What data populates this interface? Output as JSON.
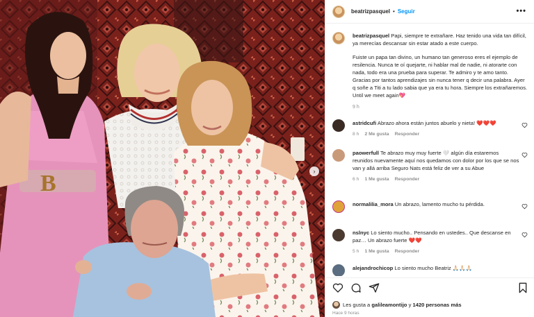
{
  "header": {
    "username": "beatrizpasquel",
    "separator": "•",
    "follow_label": "Seguir",
    "more_label": "•••"
  },
  "photo": {
    "next_label": "›",
    "belt_monogram": "B"
  },
  "caption": {
    "username": "beatrizpasquel",
    "p1": "Papi, siempre te extrañare. Haz tenido una vida tan difícil, ya merecías descansar sin estar atado a este cuerpo.",
    "p2": "Fuiste un papa tan divino, un humano tan generoso eres el ejemplo de resilencia. Nunca te oí quejarte, ni hablar mal de nadie, ni atorarte con nada, todo era una prueba para superar. Te admiro y te amo tanto. Gracias por tantos aprendizajes sin nunca tener q decir una palabra. Ayer q soñe a Titi a tu lado sabia que ya era tu hora. Siempre los extrañaremos. Until we meet again💖",
    "time": "9 h"
  },
  "comments": [
    {
      "username": "astridcufi",
      "text": "Abrazo ahora están juntos abuelo y nieta! ❤️❤️❤️",
      "time": "8 h",
      "likes": "2 Me gusta",
      "reply": "Responder",
      "avatar_color": "#3a2a24"
    },
    {
      "username": "paowerfull",
      "text": "Te abrazo muy muy fuerte 🤍 algún día estaremos reunidos nuevamente aquí nos quedamos con dolor por los que se nos van y allá arriba Seguro Nats está feliz de ver a su Abue",
      "time": "6 h",
      "likes": "1 Me gusta",
      "reply": "Responder",
      "avatar_color": "#c99a7a"
    },
    {
      "username": "normalilia_mora",
      "text": "Un abrazo, lamento mucho tu pérdida.",
      "time": "",
      "likes": "",
      "reply": "",
      "avatar_color": "#e0a33a"
    },
    {
      "username": "nslnyc",
      "text": "Lo siento mucho.. Pensando en ustedes.. Que descanse en paz… Un abrazo fuerte ❤️❤️",
      "time": "5 h",
      "likes": "1 Me gusta",
      "reply": "Responder",
      "avatar_color": "#4a3a30"
    },
    {
      "username": "alejandrochicop",
      "text": "Lo siento mucho Beatriz 🙏🏻🙏🏻🙏🏻",
      "time": "",
      "likes": "",
      "reply": "",
      "avatar_color": "#5b6d80"
    }
  ],
  "comment_like_icon": "heart-outline-icon",
  "actions": {
    "likes_prefix": "Les gusta a",
    "likes_user": "galileamontijo",
    "likes_conj": "y",
    "likes_count": "1420 personas más",
    "time_ago": "Hace 9 horas"
  },
  "colors": {
    "accent": "#0095f6",
    "heart": "#ed4956",
    "muted": "#8e8e8e"
  }
}
